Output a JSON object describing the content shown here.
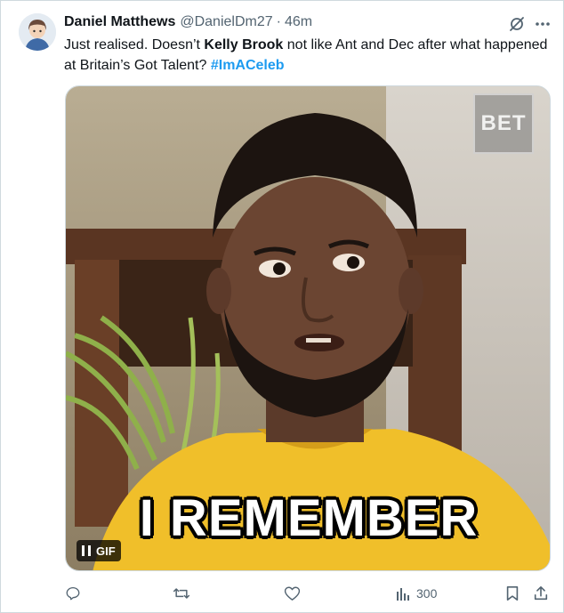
{
  "tweet": {
    "author_name": "Daniel Matthews",
    "handle": "@DanielDm27",
    "separator": "·",
    "time_ago": "46m",
    "text_parts": {
      "p1": "Just realised. Doesn’t ",
      "bold": "Kelly Brook",
      "p2": " not like Ant and Dec after what happened at Britain’s Got Talent? ",
      "hashtag": "#ImACeleb"
    }
  },
  "media": {
    "caption": "I REMEMBER",
    "watermark": "BET",
    "gif_label": "GIF"
  },
  "actions": {
    "views_count": "300"
  },
  "colors": {
    "accent": "#1d9bf0",
    "secondary_text": "#536471",
    "shirt": "#f0bf2a"
  }
}
